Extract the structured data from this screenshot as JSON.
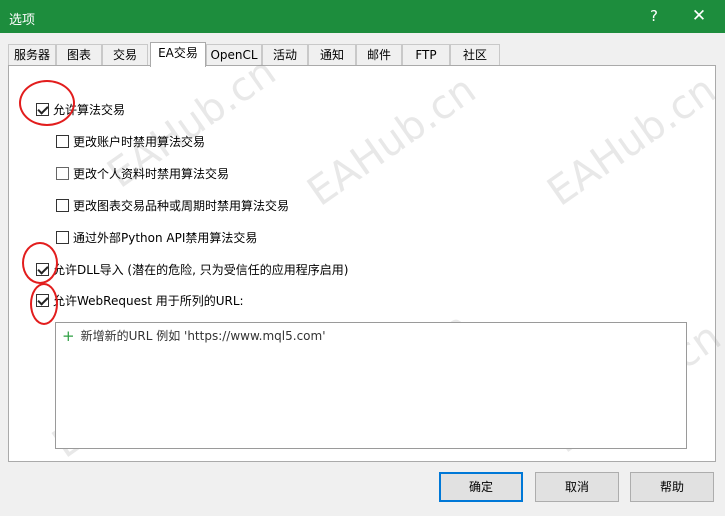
{
  "window": {
    "title": "选项",
    "help_glyph": "?",
    "close_glyph": "✕"
  },
  "tabs": [
    {
      "label": "服务器",
      "active": false
    },
    {
      "label": "图表",
      "active": false
    },
    {
      "label": "交易",
      "active": false
    },
    {
      "label": "EA交易",
      "active": true
    },
    {
      "label": "OpenCL",
      "active": false
    },
    {
      "label": "活动",
      "active": false
    },
    {
      "label": "通知",
      "active": false
    },
    {
      "label": "邮件",
      "active": false
    },
    {
      "label": "FTP",
      "active": false
    },
    {
      "label": "社区",
      "active": false
    }
  ],
  "options": {
    "allow_algo": {
      "label": "允许算法交易",
      "checked": true
    },
    "disable_on_account_change": {
      "label": "更改账户时禁用算法交易",
      "checked": false
    },
    "disable_on_profile_change": {
      "label": "更改个人资料时禁用算法交易",
      "checked": false
    },
    "disable_on_symbol_change": {
      "label": "更改图表交易品种或周期时禁用算法交易",
      "checked": false
    },
    "disable_python_api": {
      "label": "通过外部Python API禁用算法交易",
      "checked": false
    },
    "allow_dll": {
      "label": "允许DLL导入 (潜在的危险, 只为受信任的应用程序启用)",
      "checked": true
    },
    "allow_webrequest": {
      "label": "允许WebRequest 用于所列的URL:",
      "checked": true
    }
  },
  "url_list": {
    "add_glyph": "+",
    "add_label": "新增新的URL 例如 'https://www.mql5.com'"
  },
  "buttons": {
    "ok": "确定",
    "cancel": "取消",
    "help": "帮助"
  },
  "watermark_text": "EAHub.cn",
  "colors": {
    "titlebar": "#1d8d3d",
    "annotation_circle": "#e21d1d",
    "default_button_border": "#0078d7",
    "add_icon": "#2ea043"
  }
}
